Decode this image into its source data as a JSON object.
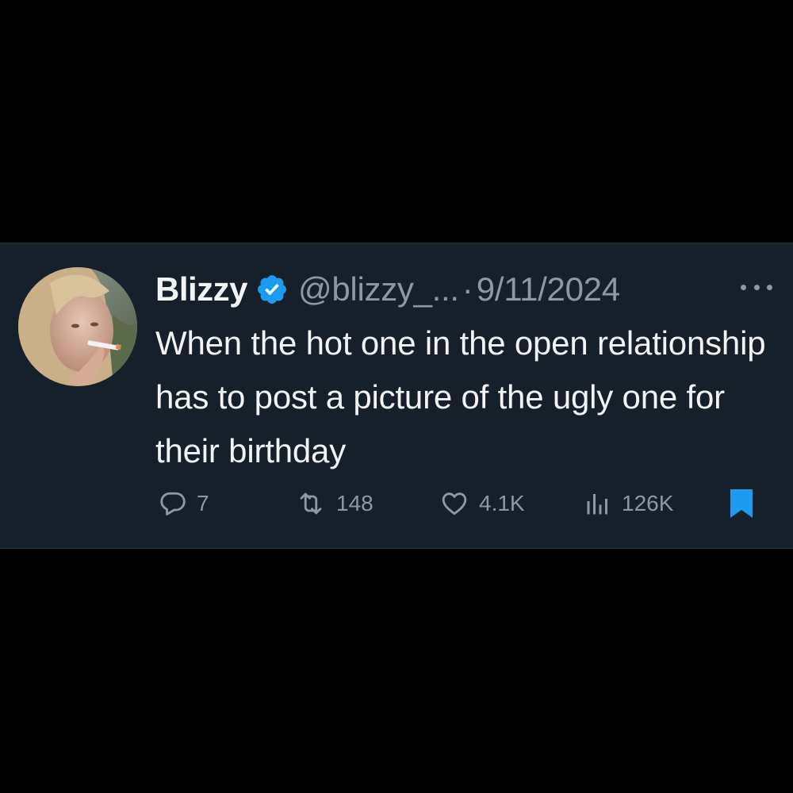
{
  "tweet": {
    "author_name": "Blizzy",
    "handle": "@blizzy_...",
    "separator": "·",
    "date": "9/11/2024",
    "text": "When the hot one in the open relationship has to post a picture of the ugly one for their birthday",
    "verified_color": "#1d9bf0"
  },
  "actions": {
    "replies": "7",
    "retweets": "148",
    "likes": "4.1K",
    "views": "126K",
    "bookmark_color": "#1d9bf0"
  },
  "icons": {
    "reply": "reply-icon",
    "retweet": "retweet-icon",
    "like": "heart-icon",
    "views": "views-icon",
    "bookmark": "bookmark-icon",
    "more": "more-icon",
    "verified": "verified-badge-icon"
  }
}
